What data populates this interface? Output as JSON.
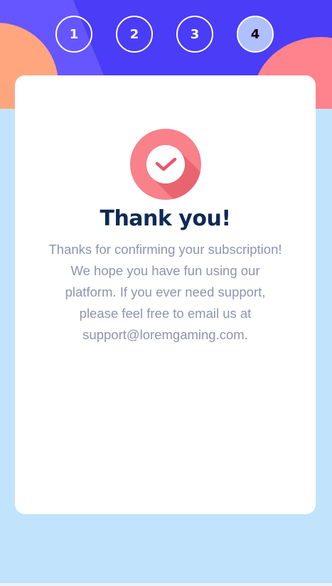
{
  "steps": [
    {
      "label": "1",
      "state": "completed"
    },
    {
      "label": "2",
      "state": "completed"
    },
    {
      "label": "3",
      "state": "completed"
    },
    {
      "label": "4",
      "state": "current"
    }
  ],
  "confirmation": {
    "icon": "checkmark-icon",
    "title": "Thank you!",
    "message_lines": [
      "Thanks for confirming your subscription!",
      "We hope you have fun using our",
      "platform. If you ever need support,",
      "please feel free to email us at",
      "support@loremgaming.com."
    ]
  },
  "colors": {
    "header": "#4a3cf7",
    "header_band": "#6656ff",
    "blob_left": "#ffa67e",
    "blob_right": "#ff838d",
    "page_background": "#c1e3fb",
    "active_step": "#b0c0ff",
    "check_circle": "#f8818a",
    "check_shadow": "#e8646f",
    "check_mark": "#e5566a",
    "title": "#0e2a55",
    "message": "#8e94ad"
  }
}
